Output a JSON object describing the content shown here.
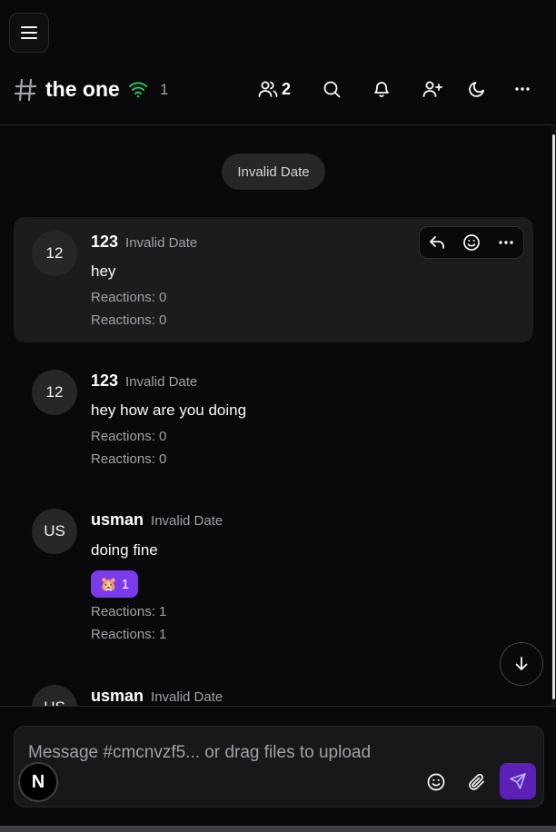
{
  "header": {
    "channel_name": "the one",
    "online_count": "1",
    "members_count": "2"
  },
  "date_separator": "Invalid Date",
  "messages": [
    {
      "avatar": "12",
      "author": "123",
      "timestamp": "Invalid Date",
      "text": "hey",
      "reactions_lines": [
        "Reactions: 0",
        "Reactions: 0"
      ]
    },
    {
      "avatar": "12",
      "author": "123",
      "timestamp": "Invalid Date",
      "text": "hey how are you doing",
      "reactions_lines": [
        "Reactions: 0",
        "Reactions: 0"
      ]
    },
    {
      "avatar": "US",
      "author": "usman",
      "timestamp": "Invalid Date",
      "text": "doing fine",
      "reaction_chip": {
        "emoji": "🐹",
        "count": "1"
      },
      "reactions_lines": [
        "Reactions: 1",
        "Reactions: 1"
      ]
    },
    {
      "avatar": "US",
      "author": "usman",
      "timestamp": "Invalid Date"
    }
  ],
  "composer": {
    "placeholder": "Message #cmcnvzf5... or drag files to upload"
  },
  "badge": {
    "letter": "N"
  },
  "colors": {
    "background": "#09090b",
    "accent": "#7c3aed",
    "send_button": "#5b21b6",
    "online_indicator": "#22c55e"
  },
  "icons": {
    "menu": "hamburger-icon",
    "channel": "hash-icon",
    "online": "wifi-icon",
    "members": "users-icon",
    "search": "search-icon",
    "notifications": "bell-icon",
    "invite": "user-plus-icon",
    "theme": "moon-icon",
    "more": "more-horizontal-icon",
    "reply": "reply-icon",
    "react": "smile-icon",
    "scroll": "arrow-down-icon",
    "attach": "paperclip-icon",
    "send": "send-icon"
  }
}
